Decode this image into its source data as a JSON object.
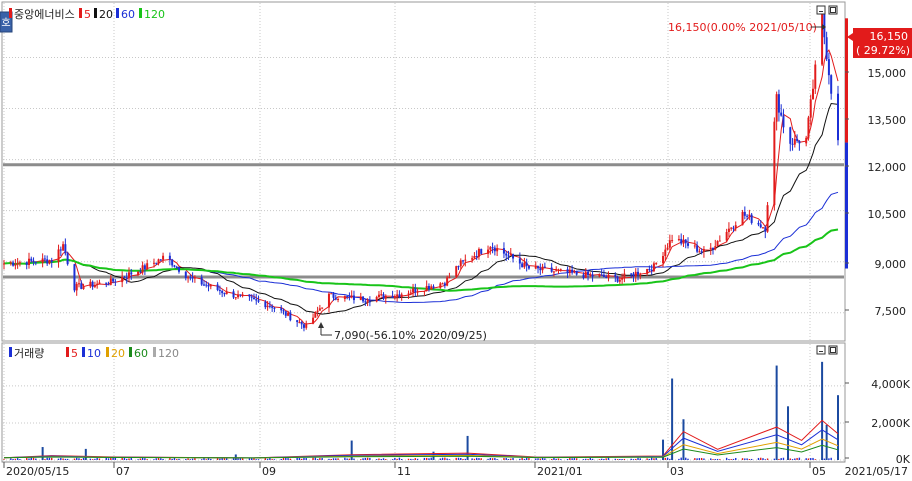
{
  "window": {
    "corner_button": "호"
  },
  "price_panel": {
    "legend": {
      "stock_name": "중앙에너비스",
      "ma_items": [
        {
          "label": "5",
          "color": "#e21b1b"
        },
        {
          "label": "20",
          "color": "#111111"
        },
        {
          "label": "60",
          "color": "#1b2fd6"
        },
        {
          "label": "120",
          "color": "#19c419"
        }
      ]
    },
    "y_ticks": [
      "15,000",
      "13,500",
      "12,000",
      "10,500",
      "9,000",
      "7,500"
    ],
    "current_price": "16,150",
    "current_change": "( 29.72%)",
    "high_annotation": "16,150(0.00% 2021/05/10)",
    "low_annotation": "7,090(-56.10% 2020/09/25)"
  },
  "volume_panel": {
    "legend": {
      "title": "거래량",
      "ma_items": [
        {
          "label": "5",
          "color": "#e21b1b"
        },
        {
          "label": "10",
          "color": "#1b2fd6"
        },
        {
          "label": "20",
          "color": "#e0a000"
        },
        {
          "label": "60",
          "color": "#1a8a1a"
        },
        {
          "label": "120",
          "color": "#aaaaaa"
        }
      ]
    },
    "y_ticks": [
      "4,000K",
      "2,000K",
      "0K"
    ]
  },
  "x_axis": {
    "ticks": [
      "2020/05/15",
      "07",
      "09",
      "11",
      "2021/01",
      "03",
      "05"
    ],
    "end_date": "2021/05/17"
  },
  "chart_data": [
    {
      "type": "candlestick",
      "title": "중앙에너비스",
      "period": {
        "start": "2020/05/15",
        "end": "2021/05/17"
      },
      "ylim": [
        6700,
        16600
      ],
      "y_ticks": [
        7500,
        9000,
        10500,
        12000,
        13500,
        15000
      ],
      "x_ticks": [
        "2020/05/15",
        "07",
        "09",
        "11",
        "2021/01",
        "03",
        "05"
      ],
      "close_path": [
        [
          "2020/05/15",
          8950
        ],
        [
          "2020/06/05",
          9050
        ],
        [
          "2020/06/10",
          9500
        ],
        [
          "2020/06/15",
          8250
        ],
        [
          "2020/07/01",
          8400
        ],
        [
          "2020/07/15",
          8800
        ],
        [
          "2020/07/25",
          9150
        ],
        [
          "2020/08/05",
          8500
        ],
        [
          "2020/08/20",
          8100
        ],
        [
          "2020/09/10",
          7700
        ],
        [
          "2020/09/25",
          7090
        ],
        [
          "2020/10/05",
          8000
        ],
        [
          "2020/10/20",
          7900
        ],
        [
          "2020/11/05",
          8050
        ],
        [
          "2020/11/25",
          8400
        ],
        [
          "2020/12/01",
          8900
        ],
        [
          "2020/12/15",
          9500
        ],
        [
          "2021/01/01",
          8800
        ],
        [
          "2021/01/20",
          8650
        ],
        [
          "2021/02/10",
          8500
        ],
        [
          "2021/02/25",
          8850
        ],
        [
          "2021/03/05",
          9700
        ],
        [
          "2021/03/20",
          9250
        ],
        [
          "2021/04/05",
          10400
        ],
        [
          "2021/04/15",
          10000
        ],
        [
          "2021/04/20",
          13800
        ],
        [
          "2021/04/25",
          12500
        ],
        [
          "2021/05/03",
          12600
        ],
        [
          "2021/05/10",
          16150
        ],
        [
          "2021/05/17",
          12500
        ]
      ],
      "moving_averages": [
        {
          "name": "5",
          "color": "#e21b1b"
        },
        {
          "name": "20",
          "color": "#111111"
        },
        {
          "name": "60",
          "color": "#1b2fd6"
        },
        {
          "name": "120",
          "color": "#19c419"
        }
      ],
      "horizontal_lines": [
        11850,
        8550
      ],
      "annotations": [
        {
          "text": "16,150(0.00% 2021/05/10)",
          "value": 16150
        },
        {
          "text": "7,090(-56.10% 2020/09/25)",
          "value": 7090
        }
      ],
      "current": {
        "price": 16150,
        "change_pct": 29.72
      }
    },
    {
      "type": "bar",
      "title": "거래량",
      "ylim": [
        0,
        5400
      ],
      "y_ticks": [
        0,
        2000,
        4000
      ],
      "unit": "K",
      "spikes": [
        [
          "2020/06/01",
          700
        ],
        [
          "2020/06/20",
          600
        ],
        [
          "2020/08/25",
          300
        ],
        [
          "2020/10/15",
          1050
        ],
        [
          "2020/11/20",
          450
        ],
        [
          "2020/12/05",
          1300
        ],
        [
          "2021/03/01",
          1100
        ],
        [
          "2021/03/05",
          4400
        ],
        [
          "2021/03/10",
          2200
        ],
        [
          "2021/04/20",
          5100
        ],
        [
          "2021/04/25",
          2900
        ],
        [
          "2021/05/10",
          5300
        ],
        [
          "2021/05/12",
          1900
        ],
        [
          "2021/05/17",
          3500
        ]
      ]
    }
  ]
}
